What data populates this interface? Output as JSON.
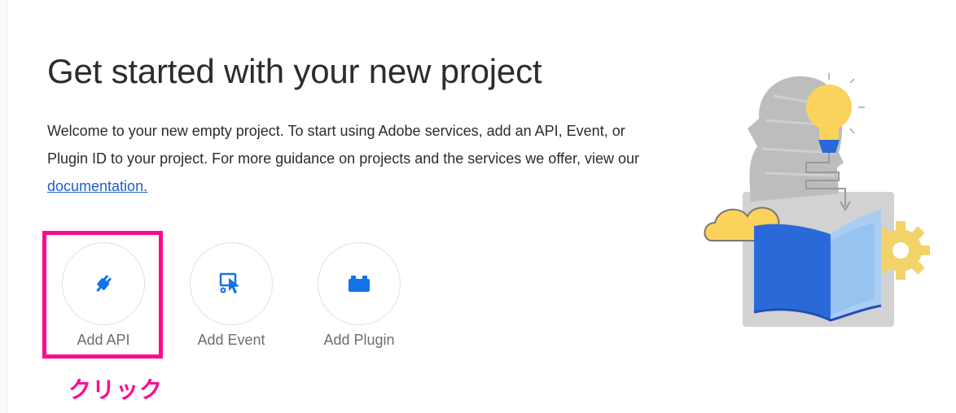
{
  "page": {
    "title": "Get started with your new project",
    "description_before_link": "Welcome to your new empty project. To start using Adobe services, add an API, Event, or Plugin ID to your project. For more guidance on projects and the services we offer, view our ",
    "documentation_link": "documentation."
  },
  "actions": [
    {
      "label": "Add API",
      "icon": "plug-icon"
    },
    {
      "label": "Add Event",
      "icon": "event-icon"
    },
    {
      "label": "Add Plugin",
      "icon": "plugin-icon"
    }
  ],
  "annotation": {
    "text": "クリック",
    "color": "#ff0a8f"
  },
  "colors": {
    "accent_blue": "#1473e6",
    "link_blue": "#1f5fc9",
    "highlight_pink": "#ff0a8f"
  }
}
